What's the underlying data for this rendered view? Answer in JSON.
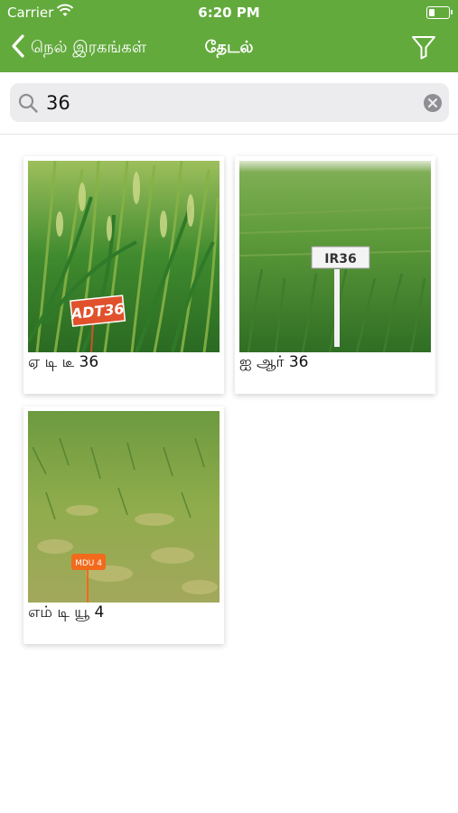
{
  "status_bar": {
    "carrier": "Carrier",
    "time": "6:20 PM"
  },
  "nav": {
    "back_label": "நெல் இரகங்கள்",
    "title": "தேடல்",
    "accent_color": "#63aa3d"
  },
  "search": {
    "value": "36",
    "placeholder": ""
  },
  "results": [
    {
      "label": "ஏ டி டீ 36",
      "sign_text": "ADT36",
      "sign_color": "#e0512c"
    },
    {
      "label": "ஐ ஆர் 36",
      "sign_text": "IR36",
      "sign_color": "#ffffff"
    },
    {
      "label": "எம் டி யூ 4",
      "sign_text": "MDU 4",
      "sign_color": "#f26a1b"
    }
  ]
}
